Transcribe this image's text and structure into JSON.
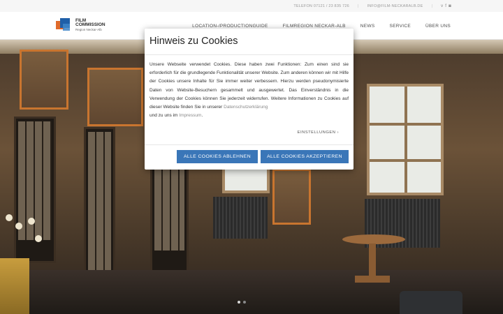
{
  "topbar": {
    "phone": "TELEFON 07121 / 23 835 726",
    "email": "INFO@FILM-NECKARALB.DE",
    "social_icons": [
      "vimeo-icon",
      "facebook-icon",
      "instagram-icon"
    ]
  },
  "logo": {
    "line1": "FILM",
    "line2": "COMMISSION",
    "line3": "Region Neckar-Alb",
    "colors": {
      "orange": "#e06b2b",
      "blue": "#1f5fa8",
      "light_blue": "#3f86c9"
    }
  },
  "nav": {
    "items": [
      "LOCATION-/PRODUCTIONGUIDE",
      "FILMREGION NECKAR-ALB",
      "NEWS",
      "SERVICE",
      "ÜBER UNS"
    ]
  },
  "modal": {
    "title": "Hinweis zu Cookies",
    "body_text": "Unsere Webseite verwendet Cookies. Diese haben zwei Funktionen: Zum einen sind sie erforderlich für die grundlegende Funktionalität unserer Website. Zum anderen können wir mit Hilfe der Cookies unsere Inhalte für Sie immer weiter verbessern. Hierzu werden pseudonymisierte Daten von Website-Besuchern gesammelt und ausgewertet. Das Einverständnis in die Verwendung der Cookies können Sie jederzeit widerrufen. Weitere Informationen zu Cookies auf dieser Website finden Sie in unserer",
    "privacy_link": "Datenschutzerklärung",
    "mid_text": "und zu uns im",
    "imprint_link": "Impressum",
    "end_text": ".",
    "settings_label": "EINSTELLUNGEN",
    "reject_label": "ALLE COOKIES ABLEHNEN",
    "accept_label": "ALLE COOKIES AKZEPTIEREN",
    "button_color": "#3a76b8"
  },
  "slider": {
    "slide_count": 2,
    "active_index": 0
  }
}
